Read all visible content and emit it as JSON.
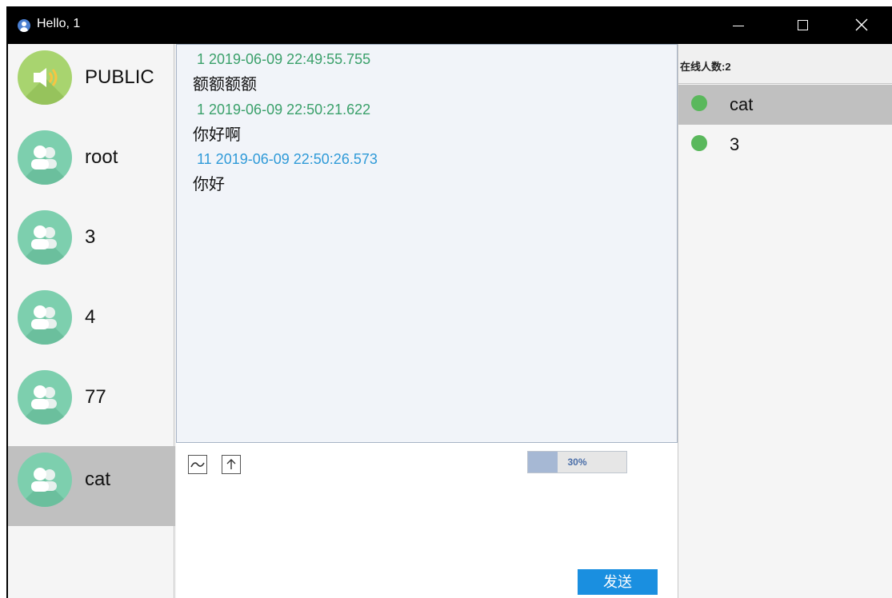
{
  "window": {
    "title": "Hello, 1"
  },
  "contacts": [
    {
      "name": "PUBLIC",
      "icon": "speaker-icon"
    },
    {
      "name": "root",
      "icon": "group-avatar-icon"
    },
    {
      "name": "3",
      "icon": "group-avatar-icon"
    },
    {
      "name": "4",
      "icon": "group-avatar-icon"
    },
    {
      "name": "77",
      "icon": "group-avatar-icon"
    },
    {
      "name": "cat",
      "icon": "group-avatar-icon",
      "selected": true
    }
  ],
  "messages": [
    {
      "meta": "1 2019-06-09 22:49:55.755",
      "text": "额额额额",
      "color": "#3aa06a"
    },
    {
      "meta": "1 2019-06-09 22:50:21.622",
      "text": "你好啊",
      "color": "#3aa06a"
    },
    {
      "meta": "11 2019-06-09 22:50:26.573",
      "text": "你好",
      "color": "#2f9ad8"
    }
  ],
  "compose": {
    "progress_label": "30%",
    "progress_value": 0.3,
    "send_label": "发送"
  },
  "online": {
    "count_label": "在线人数:2",
    "users": [
      {
        "name": "cat",
        "selected": true
      },
      {
        "name": "3"
      }
    ]
  },
  "colors": {
    "accent": "#1a8fe0",
    "online_status": "#5ab85c",
    "selected_bg": "#c0c0c0"
  }
}
